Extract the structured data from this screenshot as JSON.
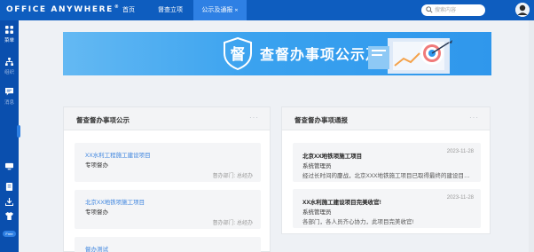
{
  "app": {
    "logo": "OFFICE ANYWHERE",
    "logo_mark": "®"
  },
  "topnav": {
    "items": [
      {
        "label": "首页"
      },
      {
        "label": "督查立项"
      },
      {
        "label": "公示及通报"
      }
    ]
  },
  "search": {
    "placeholder": "搜索内容"
  },
  "sidebar": {
    "items": [
      {
        "label": "菜单",
        "icon": "grid-icon"
      },
      {
        "label": "组织",
        "icon": "org-icon"
      },
      {
        "label": "消息",
        "icon": "message-icon"
      }
    ],
    "bottom_icons": [
      "monitor-icon",
      "note-icon",
      "download-icon",
      "shirt-icon"
    ],
    "free_badge": "Free"
  },
  "banner": {
    "shield_char": "督",
    "title": "查督办事项公示及通报"
  },
  "public_card": {
    "title": "督查督办事项公示",
    "more": "···",
    "items": [
      {
        "title": "XX水利工程施工建设项目",
        "status": "专项督办",
        "dept": "督办部门: 总经办"
      },
      {
        "title": "北京XX地铁项施工项目",
        "status": "专项督办",
        "dept": "督办部门: 总经办"
      },
      {
        "title": "督办测试",
        "status": "",
        "dept": ""
      }
    ]
  },
  "report_card": {
    "title": "督查督办事项通报",
    "more": "···",
    "items": [
      {
        "title": "北京XX地铁项施工项目",
        "date": "2023-11-28",
        "author": "系统管理员",
        "content": "经过长时间的鏖战，北京XXX地铁施工项目已取得最终的建设目标。..."
      },
      {
        "title": "XX水利施工建设项目完美收官!",
        "date": "2023-11-28",
        "author": "系统管理员",
        "content": "各部门，各人员齐心协力，此项目完美收官!"
      }
    ]
  },
  "colors": {
    "topbar": "#0e5dbf",
    "sidebar": "#0a4fae",
    "accent": "#2e80e4",
    "link": "#3b83de"
  }
}
